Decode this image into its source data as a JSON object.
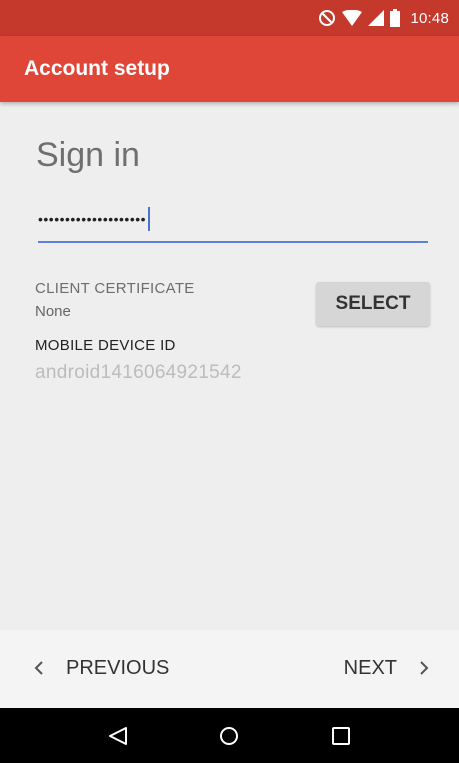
{
  "status_bar": {
    "time": "10:48",
    "icons": [
      "do-not-disturb-icon",
      "wifi-icon",
      "signal-icon",
      "battery-icon"
    ]
  },
  "app_bar": {
    "title": "Account setup"
  },
  "form": {
    "heading": "Sign in",
    "password_value": "••••••••••••••••••••"
  },
  "client_certificate": {
    "label": "CLIENT CERTIFICATE",
    "value": "None",
    "button_label": "SELECT"
  },
  "mobile_device": {
    "label": "MOBILE DEVICE ID",
    "value": "android1416064921542"
  },
  "bottom_nav": {
    "previous_label": "PREVIOUS",
    "next_label": "NEXT"
  },
  "system_nav": {
    "buttons": [
      "back-icon",
      "home-icon",
      "recents-icon"
    ]
  },
  "colors": {
    "status_bar": "#c5392c",
    "app_bar": "#e04637",
    "accent": "#5b82d6",
    "background": "#eeeeee"
  }
}
